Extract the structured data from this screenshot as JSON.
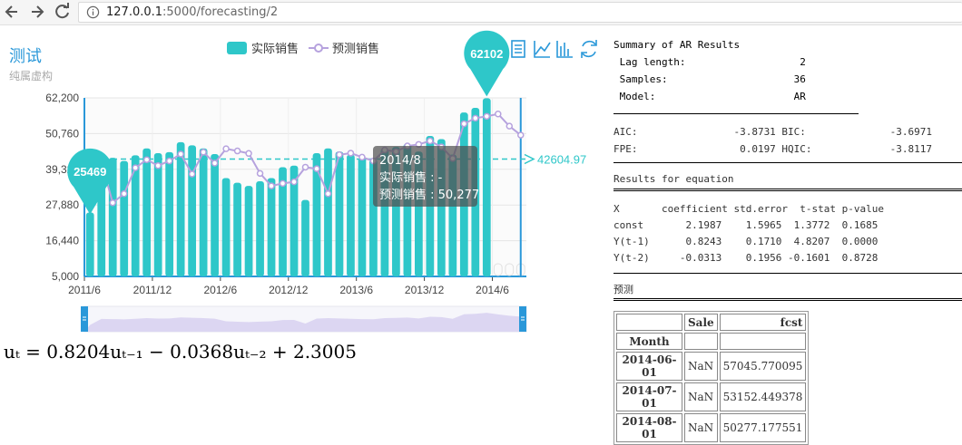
{
  "browser": {
    "url_host": "127.0.0.1",
    "url_rest": ":5000/forecasting/2"
  },
  "chart": {
    "title": "测试",
    "subtitle": "纯属虚构",
    "legend": {
      "actual": "实际销售",
      "forecast": "预测销售"
    },
    "toolbox_icons": [
      "data-view-icon",
      "line-chart-icon",
      "bar-chart-icon",
      "restore-icon"
    ],
    "mark_max_label": "62102",
    "mark_min_label": "25469",
    "avg_label": "42604.97",
    "tooltip": {
      "title": "2014/8",
      "line1": "实际销售 : -",
      "line2": "预测销售 : 50,277"
    },
    "colors": {
      "bar": "#2ec7c9",
      "line": "#b6a2de",
      "accent": "#2a98d9"
    }
  },
  "chart_data": {
    "type": "bar",
    "y_ticks": [
      "62,200",
      "50,760",
      "39,320",
      "27,880",
      "16,440",
      "5,000"
    ],
    "ylim": [
      5000,
      62200
    ],
    "x_tick_labels": [
      "2011/6",
      "2011/12",
      "2012/6",
      "2012/12",
      "2013/6",
      "2013/12",
      "2014/6"
    ],
    "categories": [
      "2011/6",
      "2011/7",
      "2011/8",
      "2011/9",
      "2011/10",
      "2011/11",
      "2011/12",
      "2012/1",
      "2012/2",
      "2012/3",
      "2012/4",
      "2012/5",
      "2012/6",
      "2012/7",
      "2012/8",
      "2012/9",
      "2012/10",
      "2012/11",
      "2012/12",
      "2013/1",
      "2013/2",
      "2013/3",
      "2013/4",
      "2013/5",
      "2013/6",
      "2013/7",
      "2013/8",
      "2013/9",
      "2013/10",
      "2013/11",
      "2013/12",
      "2014/1",
      "2014/2",
      "2014/3",
      "2014/4",
      "2014/5",
      "2014/6",
      "2014/7",
      "2014/8"
    ],
    "series": [
      {
        "name": "实际销售",
        "type": "bar",
        "values": [
          25469,
          43500,
          43000,
          42000,
          43800,
          46000,
          44500,
          44800,
          48000,
          47000,
          46000,
          44200,
          36500,
          35000,
          34000,
          35500,
          36500,
          40000,
          40500,
          29500,
          44500,
          46000,
          45000,
          44000,
          43000,
          42500,
          46000,
          46500,
          47500,
          45000,
          50000,
          49000,
          44000,
          57500,
          59000,
          62102,
          null,
          null,
          null
        ]
      },
      {
        "name": "预测销售",
        "type": "line",
        "values": [
          null,
          41600,
          28600,
          31500,
          39800,
          42400,
          40500,
          42000,
          44200,
          37800,
          44800,
          41300,
          45900,
          45200,
          44400,
          38000,
          34000,
          34800,
          35300,
          40000,
          39500,
          31500,
          44000,
          44500,
          43200,
          42000,
          45500,
          45000,
          46800,
          47300,
          48400,
          46500,
          42800,
          53900,
          55700,
          56300,
          57045.77,
          53152.45,
          50277.18
        ]
      }
    ],
    "mark_point": {
      "max": 62102,
      "min": 25469
    },
    "mark_line": {
      "average": 42604.97
    },
    "legend_position": "top-center",
    "grid": true
  },
  "formula": "u_t = 0.8204u_{t-1} - 0.0368u_{t-2} + 2.3005",
  "formula_display": "uₜ = 0.8204uₜ₋₁ − 0.0368uₜ₋₂ + 2.3005",
  "summary": {
    "heading": "Summary of AR Results",
    "lag_line": " Lag length:                   2",
    "samples_line": " Samples:                     36",
    "model_line": " Model:                       AR",
    "aic_line": "AIC:                -3.8731 BIC:              -3.6971",
    "fpe_line": "FPE:                 0.0197 HQIC:             -3.8117",
    "results_heading": "Results for equation",
    "coef_header": "X       coefficient std.error  t-stat p-value",
    "coef_rows": [
      "const       2.1987    1.5965  1.3772  0.1685",
      "Y(t-1)      0.8243    0.1710  4.8207  0.0000",
      "Y(t-2)     -0.0313    0.1956 -0.1601  0.8728"
    ],
    "forecast_heading": "预测"
  },
  "forecast_table": {
    "col_sale": "Sale",
    "col_fcst": "fcst",
    "index_name": "Month",
    "rows": [
      {
        "month": "2014-06-01",
        "sale": "NaN",
        "fcst": "57045.770095"
      },
      {
        "month": "2014-07-01",
        "sale": "NaN",
        "fcst": "53152.449378"
      },
      {
        "month": "2014-08-01",
        "sale": "NaN",
        "fcst": "50277.177551"
      }
    ]
  }
}
